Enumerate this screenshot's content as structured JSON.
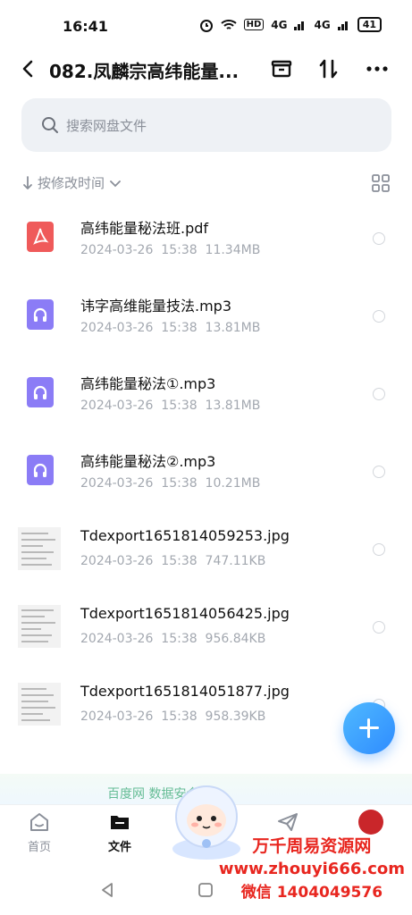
{
  "status_bar": {
    "time": "16:41",
    "indicators": [
      "HD",
      "4G",
      "4G"
    ],
    "battery": "41"
  },
  "header": {
    "title": "082.凤麟宗高纬能量...",
    "icons": [
      "back-icon",
      "archive-icon",
      "sort-arrows-icon",
      "more-icon"
    ]
  },
  "search": {
    "placeholder": "搜索网盘文件"
  },
  "sort": {
    "label": "按修改时间"
  },
  "files": [
    {
      "name": "高纬能量秘法班.pdf",
      "date": "2024-03-26",
      "time": "15:38",
      "size": "11.34MB",
      "type": "pdf"
    },
    {
      "name": "讳字高维能量技法.mp3",
      "date": "2024-03-26",
      "time": "15:38",
      "size": "13.81MB",
      "type": "audio"
    },
    {
      "name": "高纬能量秘法①.mp3",
      "date": "2024-03-26",
      "time": "15:38",
      "size": "13.81MB",
      "type": "audio"
    },
    {
      "name": "高纬能量秘法②.mp3",
      "date": "2024-03-26",
      "time": "15:38",
      "size": "10.21MB",
      "type": "audio"
    },
    {
      "name": "Tdexport1651814059253.jpg",
      "date": "2024-03-26",
      "time": "15:38",
      "size": "747.11KB",
      "type": "image"
    },
    {
      "name": "Tdexport1651814056425.jpg",
      "date": "2024-03-26",
      "time": "15:38",
      "size": "956.84KB",
      "type": "image"
    },
    {
      "name": "Tdexport1651814051877.jpg",
      "date": "2024-03-26",
      "time": "15:38",
      "size": "958.39KB",
      "type": "image"
    }
  ],
  "banner": {
    "text": "百度网 数据安全 >"
  },
  "tabs": [
    {
      "label": "首页",
      "icon": "home-icon",
      "active": false
    },
    {
      "label": "文件",
      "icon": "folder-icon",
      "active": true
    },
    {
      "label": "",
      "icon": "send-icon",
      "active": false
    }
  ],
  "watermark": {
    "line1": "万千周易资源网",
    "line2": "www.zhouyi666.com",
    "line3": "微信 1404049576"
  },
  "colors": {
    "accent": "#2f8cff",
    "pdf": "#ef5350",
    "audio": "#8b7cf6",
    "watermark": "#e8261f"
  }
}
